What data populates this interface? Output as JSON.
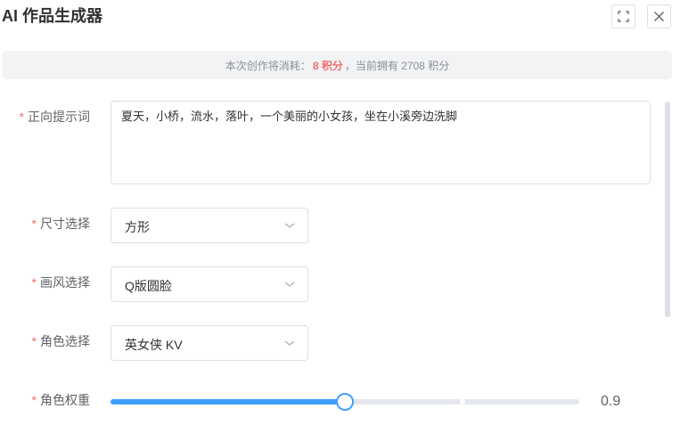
{
  "dialog": {
    "title": "AI 作品生成器",
    "fullscreen_icon": "fullscreen-icon",
    "close_icon": "close-icon"
  },
  "notice": {
    "prefix": "本次创作将消耗：",
    "cost": "8 积分",
    "suffix": "，当前拥有 2708 积分"
  },
  "form": {
    "required_mark": "*",
    "prompt": {
      "label": "正向提示词",
      "value": "夏天，小桥，流水，落叶，一个美丽的小女孩，坐在小溪旁边洗脚"
    },
    "size": {
      "label": "尺寸选择",
      "value": "方形"
    },
    "style": {
      "label": "画风选择",
      "value": "Q版圆脸"
    },
    "character": {
      "label": "角色选择",
      "value": "英女侠 KV"
    },
    "weight": {
      "label": "角色权重",
      "value": "0.9",
      "fraction": 0.5
    }
  },
  "colors": {
    "accent": "#409eff",
    "required": "#f56c6c",
    "notice_bg": "#f2f3f5"
  }
}
